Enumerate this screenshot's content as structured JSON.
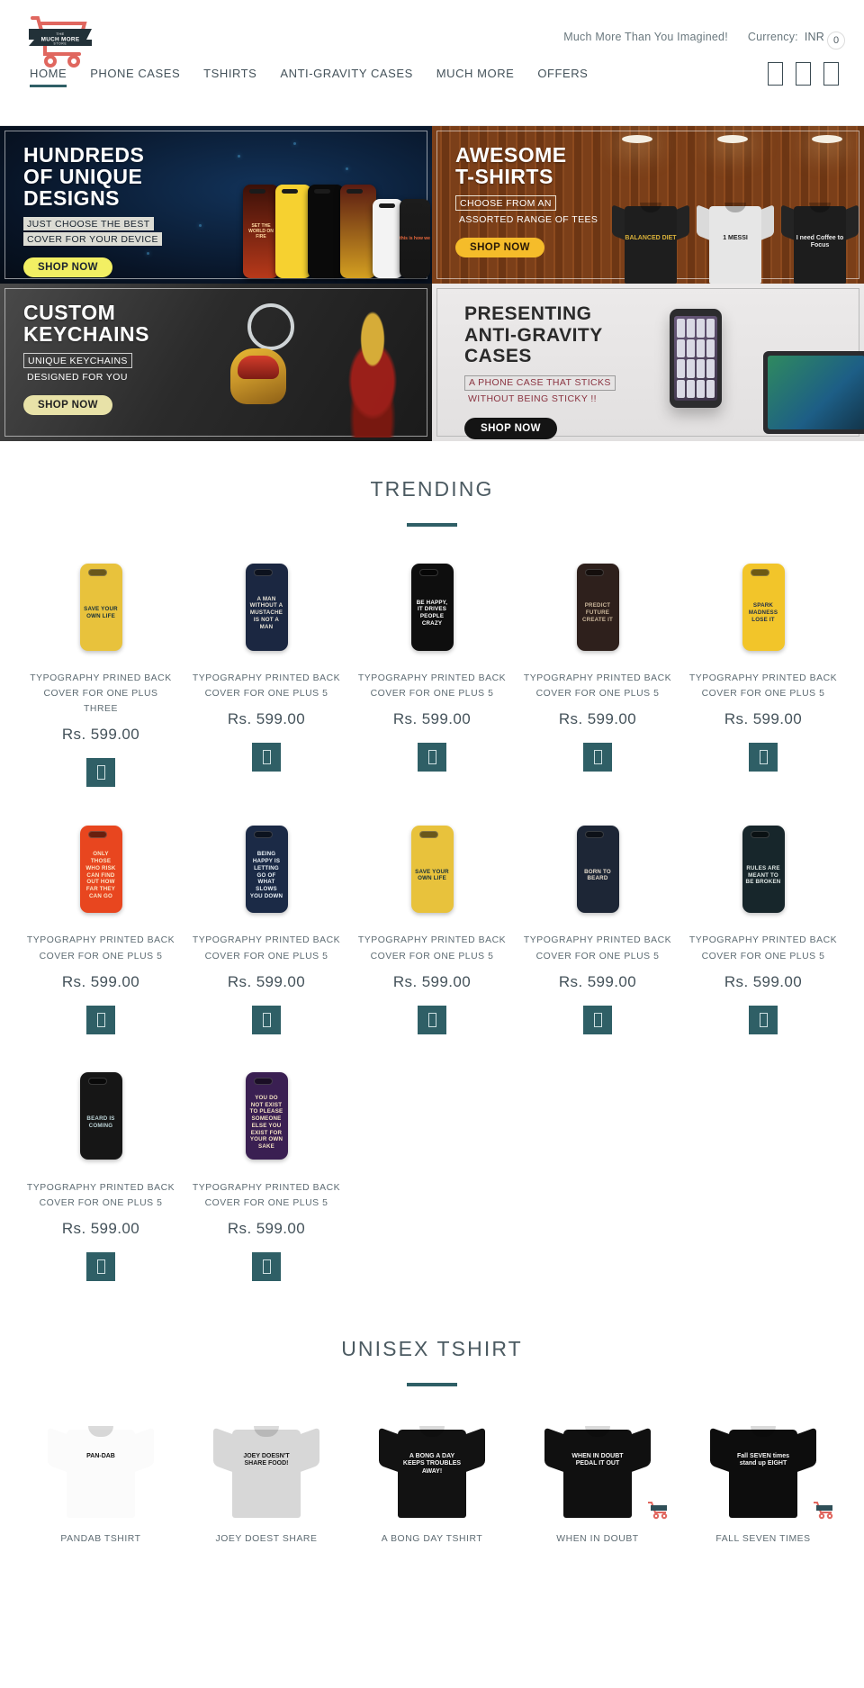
{
  "header": {
    "logo_name": "the-much-more-store-logo",
    "logo_text": "MUCH MORE",
    "logo_top_text": "THE",
    "logo_bottom_text": "STORE",
    "tagline": "Much More Than You Imagined!",
    "currency_label": "Currency:",
    "currency_value": "INR",
    "nav": [
      {
        "label": "HOME",
        "active": true
      },
      {
        "label": "PHONE CASES",
        "active": false
      },
      {
        "label": "TSHIRTS",
        "active": false
      },
      {
        "label": "ANTI-GRAVITY CASES",
        "active": false
      },
      {
        "label": "MUCH MORE",
        "active": false
      },
      {
        "label": "OFFERS",
        "active": false
      }
    ],
    "icons": {
      "search": "search-icon",
      "account": "account-icon",
      "cart": "cart-icon"
    },
    "cart_count": "0"
  },
  "banners": [
    {
      "id": "phone-cases-banner",
      "title_line1": "HUNDREDS",
      "title_line2": "OF UNIQUE",
      "title_line3": "DESIGNS",
      "sub_line1": "JUST CHOOSE THE BEST",
      "sub_line2": "COVER FOR YOUR DEVICE",
      "button": "SHOP NOW"
    },
    {
      "id": "tshirts-banner",
      "title_line1": "AWESOME",
      "title_line2": "T-SHIRTS",
      "sub_line1": "CHOOSE FROM AN",
      "sub_line2": "ASSORTED RANGE OF TEES",
      "button": "SHOP NOW"
    },
    {
      "id": "keychains-banner",
      "title_line1": "CUSTOM",
      "title_line2": "KEYCHAINS",
      "sub_line1": "UNIQUE KEYCHAINS",
      "sub_line2": "DESIGNED FOR YOU",
      "button": "SHOP NOW"
    },
    {
      "id": "anti-gravity-banner",
      "title_line1": "PRESENTING",
      "title_line2": "ANTI-GRAVITY",
      "title_line3": "CASES",
      "sub_line1": "A PHONE CASE THAT STICKS",
      "sub_line2": "WITHOUT BEING STICKY !!",
      "button": "SHOP NOW"
    }
  ],
  "banner_tee_prints": [
    "BALANCED DIET",
    "1 MESSI",
    "I need Coffee to Focus"
  ],
  "banner_case_prints": [
    "SET THE WORLD ON FIRE",
    "",
    "",
    "",
    "",
    "this is how we"
  ],
  "trending": {
    "title": "TRENDING",
    "products": [
      {
        "name": "TYPOGRAPHY PRINED BACK COVER FOR ONE PLUS THREE",
        "price": "Rs. 599.00",
        "print": "SAVE your OWN Life",
        "bg": "#e8c23c",
        "fg": "#16303a",
        "add": "add-to-cart"
      },
      {
        "name": "TYPOGRAPHY PRINTED BACK COVER FOR ONE PLUS 5",
        "price": "Rs. 599.00",
        "print": "A MAN WITHOUT A MUSTACHE IS NOT A MAN",
        "bg": "#1b2741",
        "fg": "#e8e3d6",
        "add": "add-to-cart"
      },
      {
        "name": "TYPOGRAPHY PRINTED BACK COVER FOR ONE PLUS 5",
        "price": "Rs. 599.00",
        "print": "BE HAPPY, IT DRIVES PEOPLE CRAZY",
        "bg": "#0e0e0e",
        "fg": "#ffffff",
        "add": "add-to-cart"
      },
      {
        "name": "TYPOGRAPHY PRINTED BACK COVER FOR ONE PLUS 5",
        "price": "Rs. 599.00",
        "print": "PREDICT FUTURE Create It",
        "bg": "#2e201c",
        "fg": "#cbb79b",
        "add": "add-to-cart"
      },
      {
        "name": "TYPOGRAPHY PRINTED BACK COVER FOR ONE PLUS 5",
        "price": "Rs. 599.00",
        "print": "SPARK MADNESS LOSE IT",
        "bg": "#f2c52a",
        "fg": "#22304a",
        "add": "add-to-cart"
      },
      {
        "name": "TYPOGRAPHY PRINTED BACK COVER FOR ONE PLUS 5",
        "price": "Rs. 599.00",
        "print": "Only those who RISK CAN FIND OUT HOW FAR THEY CAN GO",
        "bg": "#e8461f",
        "fg": "#fbe6c8",
        "add": "add-to-cart"
      },
      {
        "name": "TYPOGRAPHY PRINTED BACK COVER FOR ONE PLUS 5",
        "price": "Rs. 599.00",
        "print": "BEING HAPPY IS Letting Go OF WHAT SLOWS YOU DOWN",
        "bg": "#1b2a46",
        "fg": "#eaf1f6",
        "add": "add-to-cart"
      },
      {
        "name": "TYPOGRAPHY PRINTED BACK COVER FOR ONE PLUS 5",
        "price": "Rs. 599.00",
        "print": "SAVE your OWN Life",
        "bg": "#e8c23c",
        "fg": "#16303a",
        "add": "add-to-cart"
      },
      {
        "name": "TYPOGRAPHY PRINTED BACK COVER FOR ONE PLUS 5",
        "price": "Rs. 599.00",
        "print": "BORN TO BEARD",
        "bg": "#1d2636",
        "fg": "#e6dccd",
        "add": "add-to-cart"
      },
      {
        "name": "TYPOGRAPHY PRINTED BACK COVER FOR ONE PLUS 5",
        "price": "Rs. 599.00",
        "print": "RULES ARE MEANT TO BE BROKEN",
        "bg": "#17262b",
        "fg": "#dfe7e4",
        "add": "add-to-cart"
      },
      {
        "name": "TYPOGRAPHY PRINTED BACK COVER FOR ONE PLUS 5",
        "price": "Rs. 599.00",
        "print": "BEARD IS COMING",
        "bg": "#161616",
        "fg": "#bcd3d6",
        "add": "add-to-cart"
      },
      {
        "name": "TYPOGRAPHY PRINTED BACK COVER FOR ONE PLUS 5",
        "price": "Rs. 599.00",
        "print": "YOU DO NOT exist TO PLEASE SOMEONE ELSE YOU EXIST FOR YOUR OWN SAKE",
        "bg": "#3a1f52",
        "fg": "#f3e2c2",
        "add": "add-to-cart"
      }
    ]
  },
  "unisex_tshirt": {
    "title": "UNISEX TSHIRT",
    "products": [
      {
        "name": "PANDAB TSHIRT",
        "print": "PAN-DAB",
        "bg": "#fbfbfb",
        "fg": "#111111",
        "has_cart_badge": false
      },
      {
        "name": "JOEY DOEST SHARE",
        "print": "JOEY DOESN'T SHARE FOOD!",
        "bg": "#d7d7d7",
        "fg": "#1a1a1a",
        "has_cart_badge": false
      },
      {
        "name": "A BONG DAY TSHIRT",
        "print": "A BONG A DAY KEEPS TROUBLES AWAY!",
        "bg": "#121212",
        "fg": "#f2f2f2",
        "has_cart_badge": false
      },
      {
        "name": "WHEN IN DOUBT",
        "print": "WHEN IN DOUBT PEDAL IT OUT",
        "bg": "#101010",
        "fg": "#f4f4f4",
        "has_cart_badge": true
      },
      {
        "name": "FALL SEVEN TIMES",
        "print": "Fall SEVEN times stand up EIGHT",
        "bg": "#0d0d0d",
        "fg": "#f4f4f4",
        "has_cart_badge": true
      }
    ]
  },
  "colors": {
    "accent": "#2f5f66",
    "text": "#5d6b72",
    "logo_red": "#e0675f"
  }
}
